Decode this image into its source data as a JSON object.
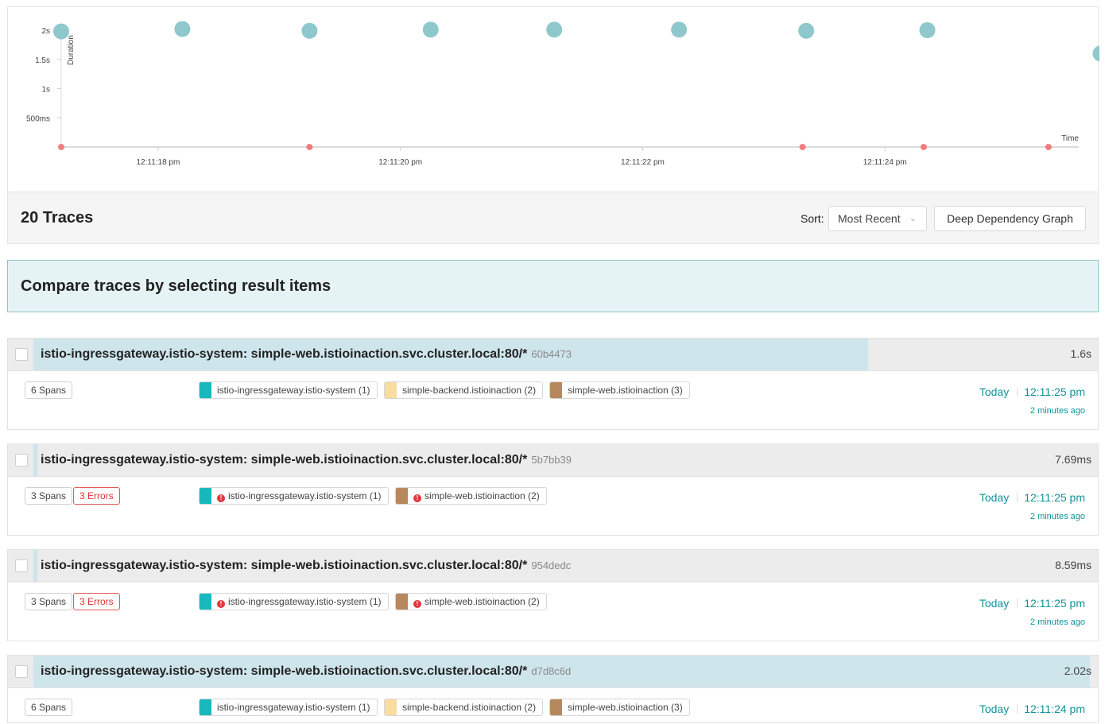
{
  "chart_data": {
    "type": "scatter",
    "xlabel": "Time",
    "ylabel": "Duration",
    "y_ticks": [
      "2s",
      "1.5s",
      "1s",
      "500ms"
    ],
    "y_tick_values": [
      2.0,
      1.5,
      1.0,
      0.5
    ],
    "x_ticks": [
      "12:11:18 pm",
      "12:11:20 pm",
      "12:11:22 pm",
      "12:11:24 pm"
    ],
    "x_tick_values": [
      18,
      20,
      22,
      24
    ],
    "xlim": [
      17.2,
      25.6
    ],
    "ylim": [
      0,
      2.0
    ],
    "points": [
      {
        "x": 17.2,
        "y": 1.98,
        "kind": "ok"
      },
      {
        "x": 18.2,
        "y": 2.02,
        "kind": "ok"
      },
      {
        "x": 19.25,
        "y": 1.99,
        "kind": "ok"
      },
      {
        "x": 20.25,
        "y": 2.01,
        "kind": "ok"
      },
      {
        "x": 21.27,
        "y": 2.01,
        "kind": "ok"
      },
      {
        "x": 22.3,
        "y": 2.01,
        "kind": "ok"
      },
      {
        "x": 23.35,
        "y": 1.99,
        "kind": "ok"
      },
      {
        "x": 24.35,
        "y": 2.0,
        "kind": "ok"
      },
      {
        "x": 25.78,
        "y": 1.6,
        "kind": "ok"
      },
      {
        "x": 17.2,
        "y": 0.0,
        "kind": "error"
      },
      {
        "x": 19.25,
        "y": 0.0,
        "kind": "error"
      },
      {
        "x": 23.32,
        "y": 0.0,
        "kind": "error"
      },
      {
        "x": 24.32,
        "y": 0.0,
        "kind": "error"
      },
      {
        "x": 25.35,
        "y": 0.0,
        "kind": "error"
      }
    ],
    "colors": {
      "ok": "#8fc8cc",
      "error": "#f06a6a"
    },
    "grid": false
  },
  "header": {
    "trace_count": "20 Traces",
    "sort_label": "Sort:",
    "sort_value": "Most Recent",
    "ddg_label": "Deep Dependency Graph"
  },
  "compare_banner": "Compare traces by selecting result items",
  "services": {
    "gateway": {
      "color": "#17b8be"
    },
    "backend": {
      "color": "#f8dca1"
    },
    "web": {
      "color": "#b7885e"
    }
  },
  "traces": [
    {
      "title": "istio-ingressgateway.istio-system: simple-web.istioinaction.svc.cluster.local:80/*",
      "trace_id": "60b4473",
      "duration": "1.6s",
      "duration_fraction": 0.79,
      "spans": "6 Spans",
      "errors": "",
      "svc_tags": [
        {
          "label": "istio-ingressgateway.istio-system (1)",
          "svc": "gateway",
          "error": false
        },
        {
          "label": "simple-backend.istioinaction (2)",
          "svc": "backend",
          "error": false
        },
        {
          "label": "simple-web.istioinaction (3)",
          "svc": "web",
          "error": false
        }
      ],
      "day": "Today",
      "time": "12:11:25 pm",
      "ago": "2 minutes ago"
    },
    {
      "title": "istio-ingressgateway.istio-system: simple-web.istioinaction.svc.cluster.local:80/*",
      "trace_id": "5b7bb39",
      "duration": "7.69ms",
      "duration_fraction": 0.004,
      "spans": "3 Spans",
      "errors": "3 Errors",
      "svc_tags": [
        {
          "label": "istio-ingressgateway.istio-system (1)",
          "svc": "gateway",
          "error": true
        },
        {
          "label": "simple-web.istioinaction (2)",
          "svc": "web",
          "error": true
        }
      ],
      "day": "Today",
      "time": "12:11:25 pm",
      "ago": "2 minutes ago"
    },
    {
      "title": "istio-ingressgateway.istio-system: simple-web.istioinaction.svc.cluster.local:80/*",
      "trace_id": "954dedc",
      "duration": "8.59ms",
      "duration_fraction": 0.004,
      "spans": "3 Spans",
      "errors": "3 Errors",
      "svc_tags": [
        {
          "label": "istio-ingressgateway.istio-system (1)",
          "svc": "gateway",
          "error": true
        },
        {
          "label": "simple-web.istioinaction (2)",
          "svc": "web",
          "error": true
        }
      ],
      "day": "Today",
      "time": "12:11:25 pm",
      "ago": "2 minutes ago"
    },
    {
      "title": "istio-ingressgateway.istio-system: simple-web.istioinaction.svc.cluster.local:80/*",
      "trace_id": "d7d8c6d",
      "duration": "2.02s",
      "duration_fraction": 1.0,
      "spans": "6 Spans",
      "errors": "",
      "svc_tags": [
        {
          "label": "istio-ingressgateway.istio-system (1)",
          "svc": "gateway",
          "error": false
        },
        {
          "label": "simple-backend.istioinaction (2)",
          "svc": "backend",
          "error": false
        },
        {
          "label": "simple-web.istioinaction (3)",
          "svc": "web",
          "error": false
        }
      ],
      "day": "Today",
      "time": "12:11:24 pm",
      "ago": ""
    }
  ]
}
